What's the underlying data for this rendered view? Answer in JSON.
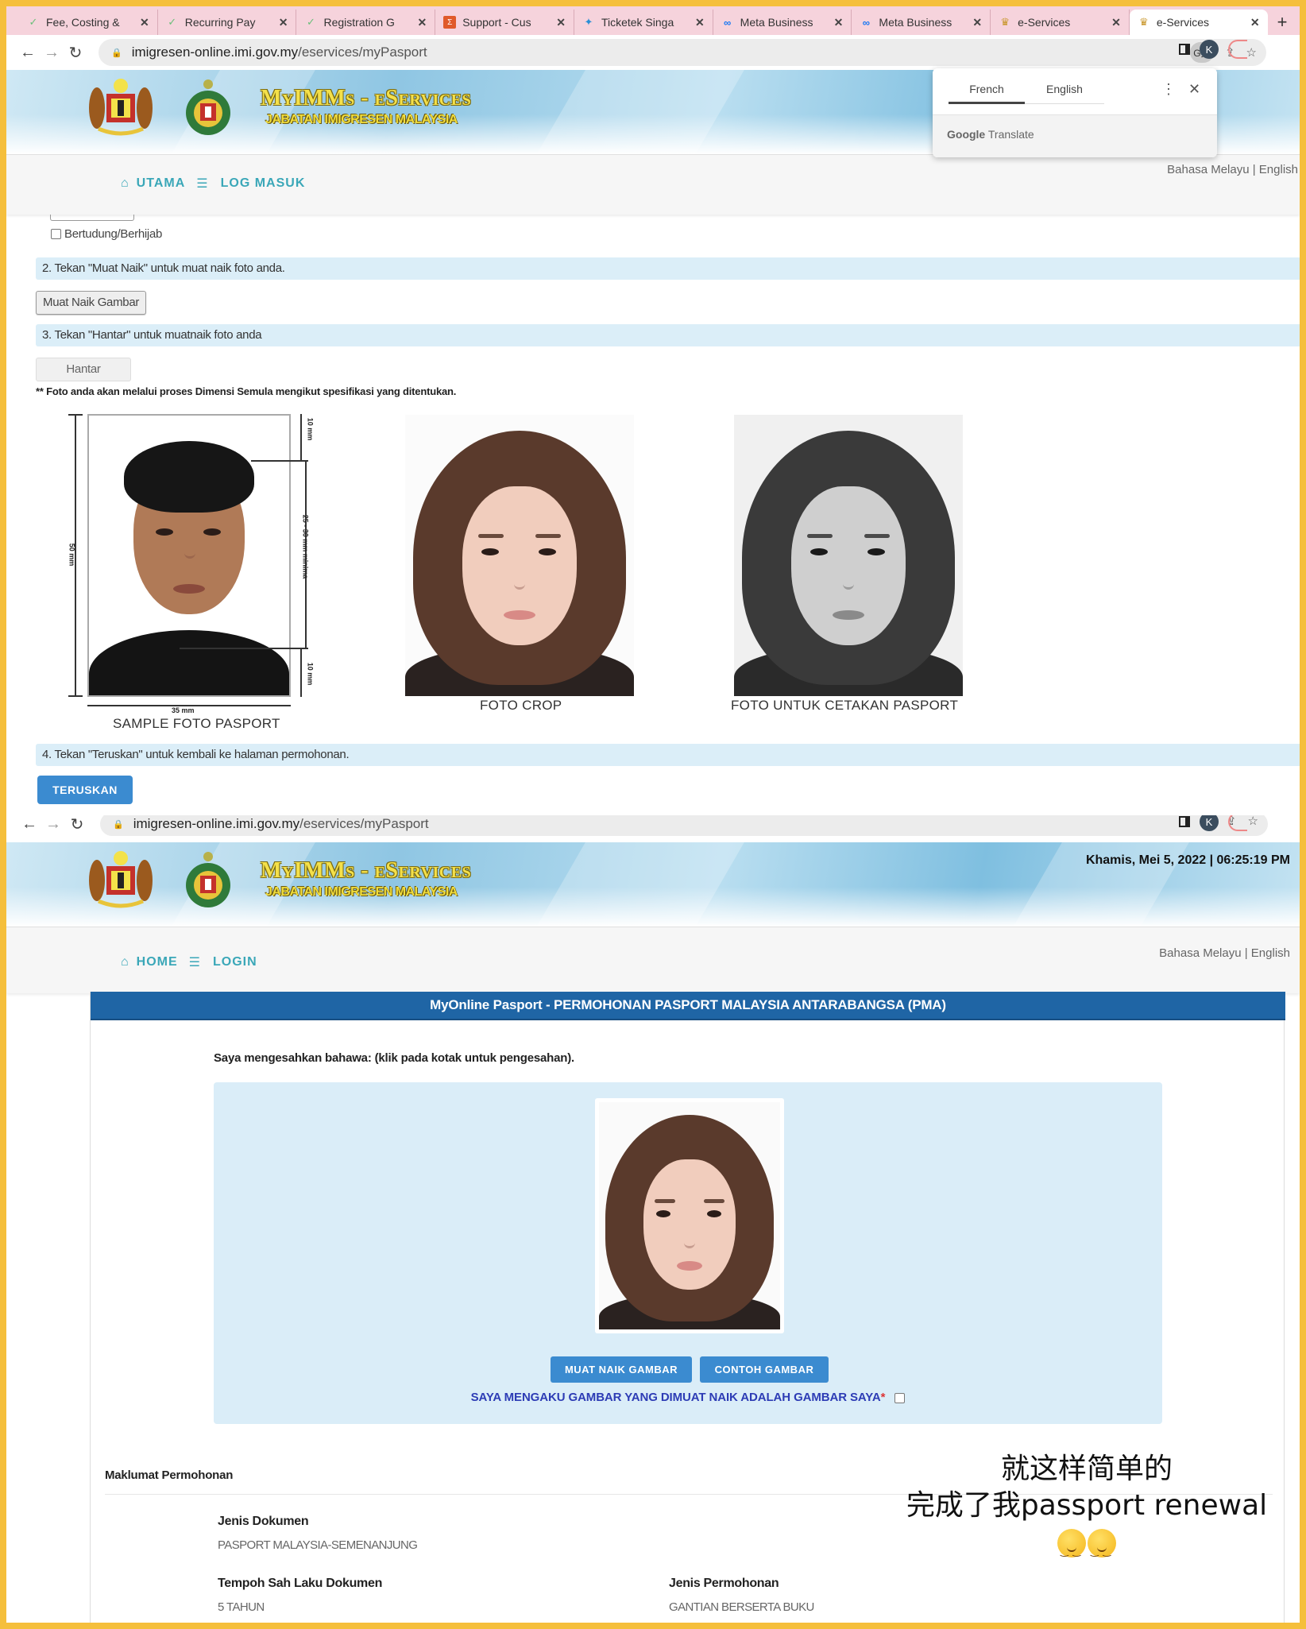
{
  "browser": {
    "tabs": [
      {
        "label": "Fee, Costing &",
        "icon": "check-icon",
        "active": false
      },
      {
        "label": "Recurring Pay",
        "icon": "check-icon",
        "active": false
      },
      {
        "label": "Registration G",
        "icon": "check-icon",
        "active": false
      },
      {
        "label": "Support - Cus",
        "icon": "zendesk-icon",
        "active": false
      },
      {
        "label": "Ticketek Singa",
        "icon": "ticketek-icon",
        "active": false
      },
      {
        "label": "Meta Business",
        "icon": "meta-icon",
        "active": false
      },
      {
        "label": "Meta Business",
        "icon": "meta-icon",
        "active": false
      },
      {
        "label": "e-Services",
        "icon": "crest-icon",
        "active": false
      },
      {
        "label": "e-Services",
        "icon": "crest-icon",
        "active": true
      }
    ],
    "url_domain": "imigresen-online.imi.gov.my",
    "url_path": "/eservices/myPasport",
    "profile_initial": "K"
  },
  "translate_popup": {
    "tabs": [
      "French",
      "English"
    ],
    "active_tab": "French",
    "footer_brand": "Google",
    "footer_product": "Translate"
  },
  "site": {
    "title": "MyIMMs - eServices",
    "subtitle": "JABATAN IMIGRESEN MALAYSIA",
    "lang_switch": "Bahasa Melayu | English"
  },
  "top_page": {
    "nav": {
      "home": "UTAMA",
      "login": "LOG MASUK"
    },
    "hijab_label": "Bertudung/Berhijab",
    "step2": "2. Tekan \"Muat Naik\" untuk muat naik foto anda.",
    "upload_button": "Muat Naik Gambar",
    "step3": "3. Tekan \"Hantar\" untuk muatnaik foto anda",
    "submit_button": "Hantar",
    "note": "** Foto anda akan melalui proses Dimensi Semula mengikut spesifikasi yang ditentukan.",
    "sample": {
      "caption": "SAMPLE FOTO PASPORT",
      "height_label": "50 mm",
      "width_label": "35 mm",
      "top_margin_label": "10 mm",
      "face_label": "25 - 30 mm minima",
      "bottom_label": "10 mm"
    },
    "crop_caption": "FOTO CROP",
    "print_caption": "FOTO UNTUK CETAKAN PASPORT",
    "step4": "4. Tekan \"Teruskan\" untuk kembali ke halaman permohonan.",
    "continue_button": "TERUSKAN"
  },
  "bottom_page": {
    "datetime": "Khamis, Mei 5, 2022 | 06:25:19 PM",
    "nav": {
      "home": "HOME",
      "login": "LOGIN"
    },
    "panel_title": "MyOnline Pasport - PERMOHONAN PASPORT MALAYSIA ANTARABANGSA (PMA)",
    "confirm_text": "Saya mengesahkan bahawa: (klik pada kotak untuk pengesahan).",
    "upload_button": "MUAT NAIK GAMBAR",
    "sample_button": "CONTOH GAMBAR",
    "ack_text": "SAYA MENGAKU GAMBAR YANG DIMUAT NAIK ADALAH GAMBAR SAYA",
    "ack_required": "*",
    "ack_checked": false,
    "section_title": "Maklumat Permohonan",
    "fields": [
      {
        "label": "Jenis Dokumen",
        "value": "PASPORT MALAYSIA-SEMENANJUNG"
      },
      {
        "label": "Tempoh Sah Laku Dokumen",
        "value": "5 TAHUN"
      },
      {
        "label": "Jenis Permohonan",
        "value": "GANTIAN BERSERTA BUKU"
      }
    ]
  },
  "caption_overlay": {
    "line1": "就这样简单的",
    "line2": "完成了我passport renewal",
    "emoji": "relieved-face-emoji x2"
  }
}
